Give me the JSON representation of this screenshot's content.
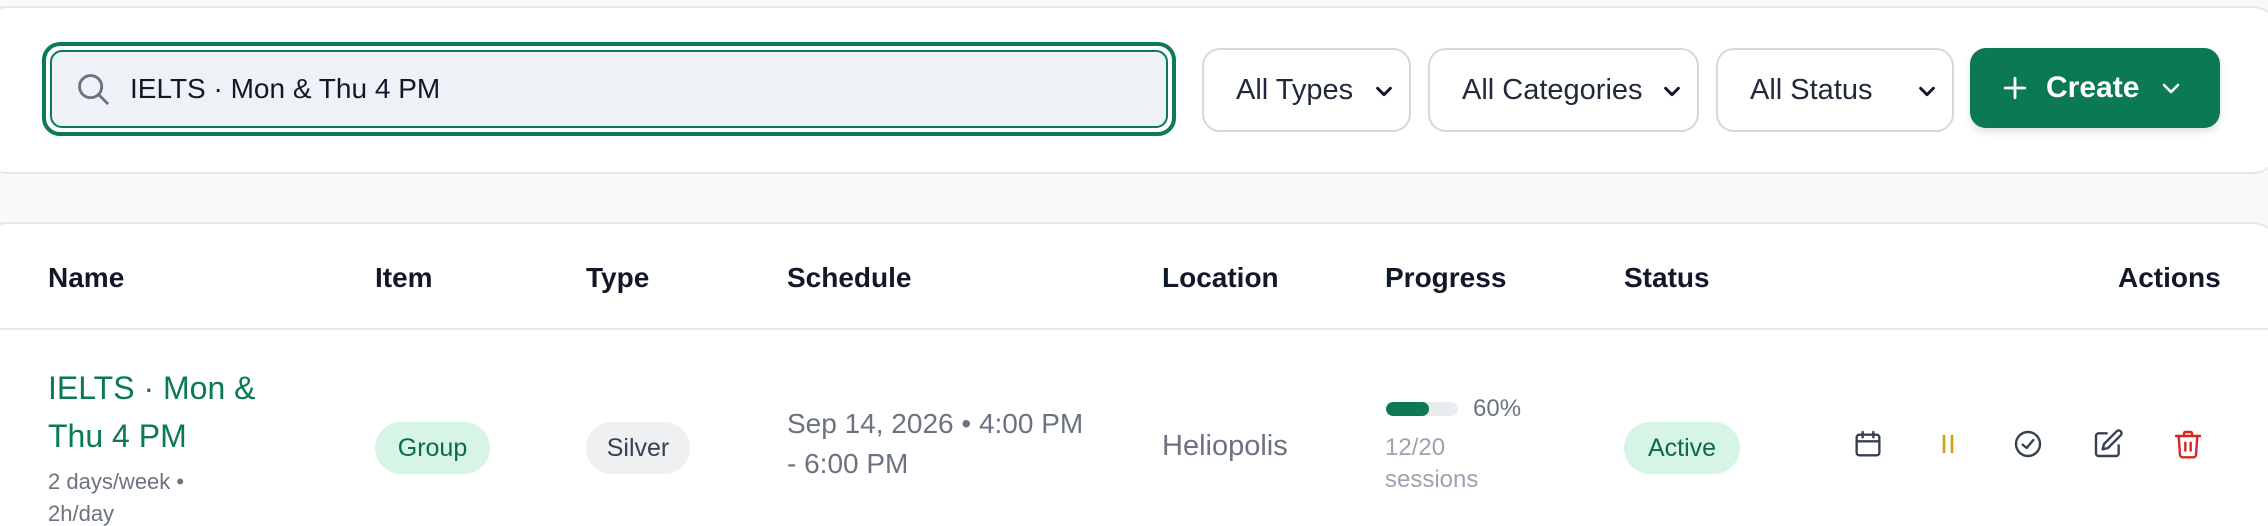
{
  "search": {
    "value": "IELTS · Mon & Thu 4 PM",
    "placeholder": ""
  },
  "filters": {
    "types": "All Types",
    "categories": "All Categories",
    "status": "All Status"
  },
  "create_button": {
    "label": "Create"
  },
  "colors": {
    "accent": "#0b7a53",
    "active_pill_bg": "#d7f5e4",
    "group_pill_bg": "#d7f5e4",
    "silver_pill_bg": "#eef0f2",
    "pause_icon": "#d4a017",
    "delete_icon": "#dc2626"
  },
  "table": {
    "headers": [
      "Name",
      "Item",
      "Type",
      "Schedule",
      "Location",
      "Progress",
      "Status",
      "Actions"
    ],
    "rows": [
      {
        "name": "IELTS · Mon & Thu 4 PM",
        "meta": "2 days/week • 2h/day",
        "item": "Group",
        "type": "Silver",
        "schedule": "Sep 14, 2026 • 4:00 PM - 6:00 PM",
        "location": "Heliopolis",
        "progress_fraction": 0.6,
        "progress_label": "60%",
        "sessions": "12/20 sessions",
        "status": "Active",
        "actions": [
          "calendar-icon",
          "pause-icon",
          "check-circle-icon",
          "edit-icon",
          "trash-icon"
        ]
      }
    ]
  }
}
